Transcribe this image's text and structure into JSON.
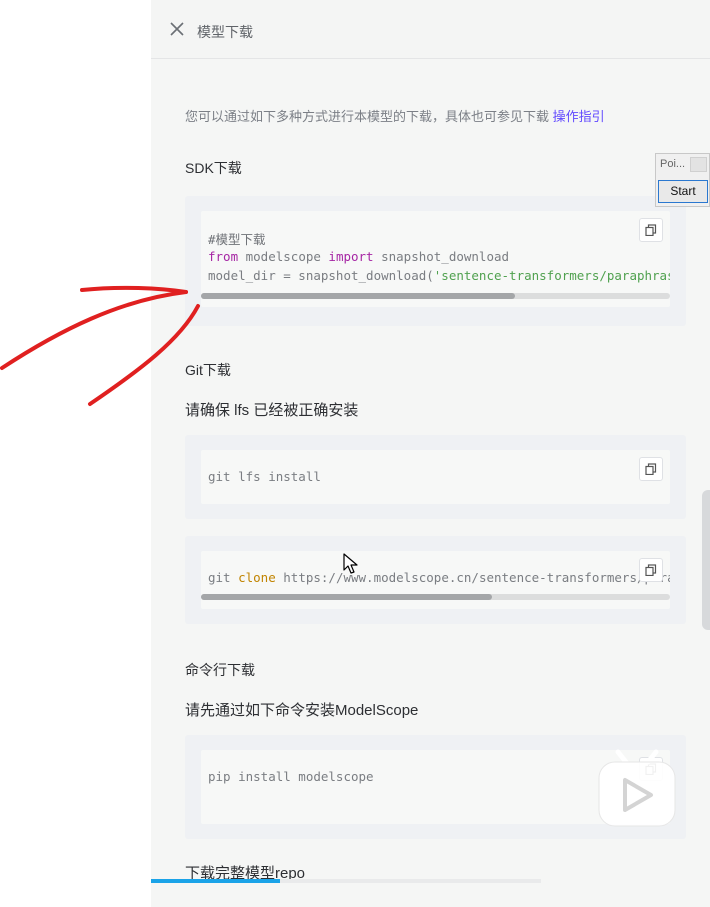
{
  "header": {
    "title": "模型下载"
  },
  "intro": {
    "text": "您可以通过如下多种方式进行本模型的下载，具体也可参见下载 ",
    "link": "操作指引"
  },
  "sdk": {
    "title": "SDK下载",
    "lines": {
      "comment": "#模型下载",
      "l2_from": "from",
      "l2_mid": " modelscope ",
      "l2_import": "import",
      "l2_end": " snapshot_download",
      "l3_start": "model_dir = snapshot_download(",
      "l3_str": "'sentence-transformers/paraphras"
    },
    "scroll_fraction": 0.67
  },
  "git": {
    "title": "Git下载",
    "subtitle": "请确保 lfs 已经被正确安装",
    "lfs_cmd": "git lfs install",
    "clone": {
      "cmd1": "git ",
      "cmd2": "clone",
      "cmd3": " https://www.modelscope.cn/sentence-transformers/para"
    },
    "scroll_fraction": 0.62
  },
  "cli": {
    "title": "命令行下载",
    "subtitle": "请先通过如下命令安装ModelScope",
    "pip_cmd": "pip install modelscope"
  },
  "repo": {
    "subtitle": "下载完整模型repo"
  },
  "floating_window": {
    "title": "Poi...",
    "start_label": "Start"
  },
  "video_progress": 0.33,
  "colors": {
    "accent_link": "#624aff",
    "progress": "#1aa3e8",
    "annotation": "#e02020"
  },
  "icons": [
    "close-icon",
    "copy-icon",
    "mouse-cursor-icon",
    "bilibili-play-icon"
  ]
}
